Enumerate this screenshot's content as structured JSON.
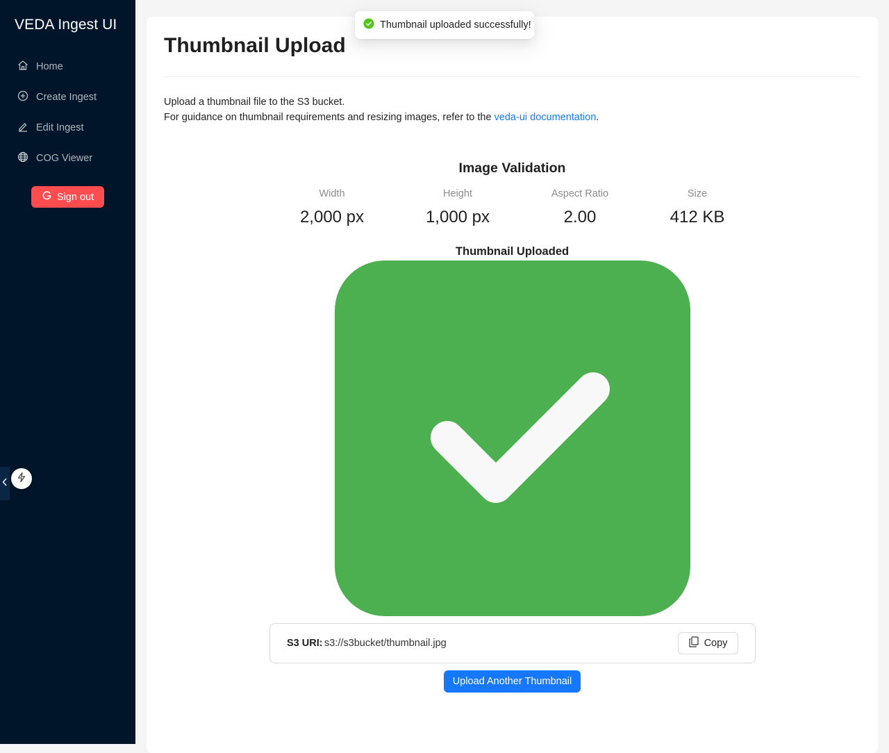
{
  "sidebar": {
    "brand": "VEDA Ingest UI",
    "items": [
      {
        "label": "Home",
        "icon": "home-icon"
      },
      {
        "label": "Create Ingest",
        "icon": "plus-circle-icon"
      },
      {
        "label": "Edit Ingest",
        "icon": "edit-icon"
      },
      {
        "label": "COG Viewer",
        "icon": "globe-icon"
      }
    ],
    "signout_label": "Sign out"
  },
  "toast": {
    "message": "Thumbnail uploaded successfully!",
    "status": "success"
  },
  "page": {
    "title": "Thumbnail Upload",
    "desc_line1": "Upload a thumbnail file to the S3 bucket.",
    "desc_line2_prefix": "For guidance on thumbnail requirements and resizing images, refer to the ",
    "desc_link": "veda-ui documentation",
    "desc_line2_suffix": "."
  },
  "validation": {
    "title": "Image Validation",
    "stats": [
      {
        "label": "Width",
        "value": "2,000 px"
      },
      {
        "label": "Height",
        "value": "1,000 px"
      },
      {
        "label": "Aspect Ratio",
        "value": "2.00"
      },
      {
        "label": "Size",
        "value": "412 KB"
      }
    ]
  },
  "preview": {
    "title": "Thumbnail Uploaded"
  },
  "s3": {
    "label": "S3 URI:",
    "value": "s3://s3bucket/thumbnail.jpg",
    "copy_label": "Copy"
  },
  "actions": {
    "upload_again_label": "Upload Another Thumbnail"
  },
  "colors": {
    "sidebar_bg": "#001529",
    "primary": "#1677ff",
    "danger": "#ff4d4f",
    "success": "#52c41a",
    "thumbnail_green": "#4caf50"
  }
}
